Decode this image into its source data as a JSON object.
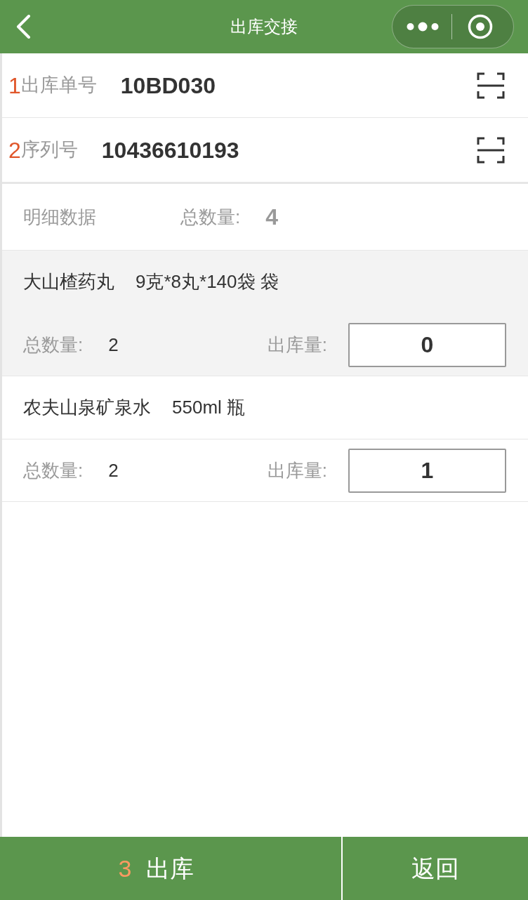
{
  "header": {
    "title": "出库交接"
  },
  "fields": [
    {
      "marker": "1",
      "label": "出库单号",
      "value": "10BD030"
    },
    {
      "marker": "2",
      "label": "序列号",
      "value": "10436610193"
    }
  ],
  "summary": {
    "label": "明细数据",
    "total_label": "总数量:",
    "total": "4"
  },
  "items": [
    {
      "name": "大山楂药丸",
      "spec": "9克*8丸*140袋 袋",
      "selected": true,
      "total_label": "总数量:",
      "total": "2",
      "out_label": "出库量:",
      "out_value": "0"
    },
    {
      "name": "农夫山泉矿泉水",
      "spec": "550ml 瓶",
      "selected": false,
      "total_label": "总数量:",
      "total": "2",
      "out_label": "出库量:",
      "out_value": "1"
    }
  ],
  "buttons": [
    {
      "marker": "3",
      "label": "出库"
    },
    {
      "label": "返回"
    }
  ]
}
